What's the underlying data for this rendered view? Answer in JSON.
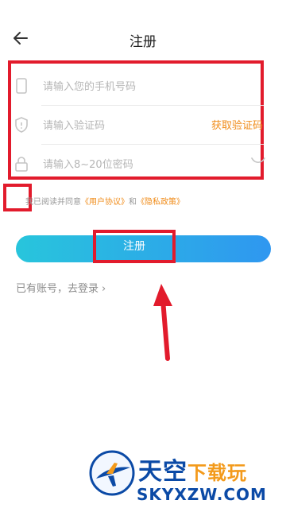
{
  "header": {
    "title": "注册"
  },
  "form": {
    "phone_placeholder": "请输入您的手机号码",
    "code_placeholder": "请输入验证码",
    "get_code_label": "获取验证码",
    "password_placeholder": "请输入8~20位密码"
  },
  "agreement": {
    "prefix": "我已阅读并同意",
    "user_agreement": "《用户协议》",
    "and": "和",
    "privacy_policy": "《隐私政策》"
  },
  "actions": {
    "register_label": "注册",
    "login_link": "已有账号，去登录",
    "login_chevron": "›"
  },
  "watermark": {
    "cn_part1": "天空",
    "cn_part2": "下载玩",
    "en": "SKYXZW.COM"
  },
  "colors": {
    "accent_orange": "#f08c1a",
    "gradient_start": "#28c5dc",
    "gradient_end": "#2f97f0",
    "annotation_red": "#e21b2c"
  }
}
